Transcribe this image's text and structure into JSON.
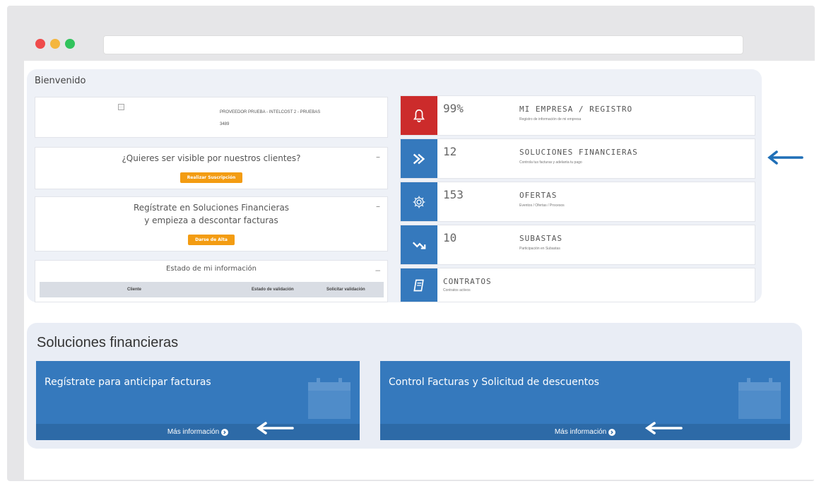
{
  "colors": {
    "dot_red": "#ef4b4b",
    "dot_yellow": "#f4b63e",
    "dot_green": "#31c35c",
    "tile_red": "#cc2b2b",
    "tile_blue": "#3579bd",
    "orange": "#f39c12",
    "arrow_blue": "#1f6fb7"
  },
  "welcome": "Bienvenido",
  "profile": {
    "company": "PROVEEDOR PRUEBA - INTELCOST 2 - PRUEBAS",
    "code": "3489"
  },
  "visible_card": {
    "question": "¿Quieres ser visible por nuestros clientes?",
    "button": "Realizar Suscripción"
  },
  "register_card": {
    "line1": "Regístrate en Soluciones Financieras",
    "line2": "y empieza a descontar facturas",
    "button": "Darse de Alta"
  },
  "info_card": {
    "title": "Estado de mi información",
    "columns": [
      "Cliente",
      "Estado de validación",
      "Solicitar validación"
    ]
  },
  "tiles": [
    {
      "icon": "bell-icon",
      "value": "99%",
      "title": "MI EMPRESA / REGISTRO",
      "subtitle": "Registro de información de mi empresa"
    },
    {
      "icon": "double-chevron-icon",
      "value": "12",
      "title": "SOLUCIONES FINANCIERAS",
      "subtitle": "Controla tus facturas y adelanta tu pago"
    },
    {
      "icon": "gear-icon",
      "value": "153",
      "title": "OFERTAS",
      "subtitle": "Eventos / Ofertas / Procesos"
    },
    {
      "icon": "trend-down-icon",
      "value": "10",
      "title": "SUBASTAS",
      "subtitle": "Participación en Subastas"
    },
    {
      "icon": "book-icon",
      "value": "",
      "title": "CONTRATOS",
      "subtitle": "Contratos activos"
    }
  ],
  "financial": {
    "title": "Soluciones financieras",
    "cards": [
      {
        "heading": "Regístrate para anticipar facturas",
        "link": "Más información"
      },
      {
        "heading": "Control Facturas y Solicitud de descuentos",
        "link": "Más información"
      }
    ]
  }
}
